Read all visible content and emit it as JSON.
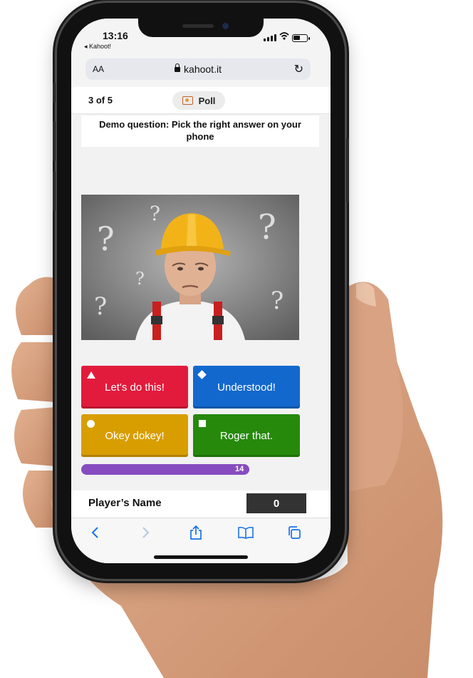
{
  "status_bar": {
    "time": "13:16",
    "back_app": "◂ Kahoot!"
  },
  "browser": {
    "text_size_label": "AA",
    "url": "kahoot.it"
  },
  "quiz": {
    "progress": "3 of 5",
    "mode_label": "Poll",
    "question": "Demo question: Pick the right answer on your phone",
    "answers": [
      {
        "label": "Let's do this!",
        "color": "#e21b3c",
        "shape": "triangle"
      },
      {
        "label": "Understood!",
        "color": "#1368ce",
        "shape": "diamond"
      },
      {
        "label": "Okey dokey!",
        "color": "#d89e00",
        "shape": "circle"
      },
      {
        "label": "Roger that.",
        "color": "#26890c",
        "shape": "square"
      }
    ],
    "timer": {
      "value": "14",
      "fraction_remaining": 0.77,
      "color": "#864cbf"
    }
  },
  "player": {
    "name": "Player’s Name",
    "score": "0"
  },
  "icons": {
    "toolbar": [
      "back-icon",
      "forward-icon",
      "share-icon",
      "bookmarks-icon",
      "tabs-icon"
    ]
  },
  "accents": {
    "kahoot_purple": "#864cbf",
    "safari_blue": "#1a73e8"
  }
}
